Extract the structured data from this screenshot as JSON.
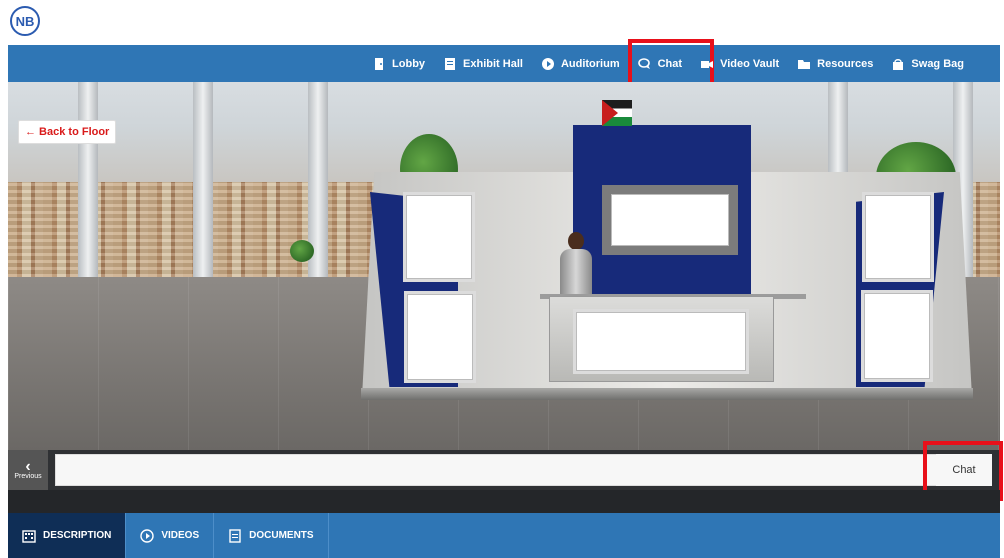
{
  "header": {
    "logo_text": "NB"
  },
  "nav": {
    "items": [
      {
        "label": "Lobby",
        "icon": "door-icon"
      },
      {
        "label": "Exhibit Hall",
        "icon": "booth-icon"
      },
      {
        "label": "Auditorium",
        "icon": "play-circle-icon"
      },
      {
        "label": "Chat",
        "icon": "chat-bubble-icon"
      },
      {
        "label": "Video Vault",
        "icon": "video-camera-icon"
      },
      {
        "label": "Resources",
        "icon": "folder-icon"
      },
      {
        "label": "Swag Bag",
        "icon": "bag-icon"
      }
    ]
  },
  "scene": {
    "back_label": "← Back to Floor"
  },
  "controls": {
    "previous_label": "Previous",
    "chat_label": "Chat"
  },
  "tabs": [
    {
      "label": "DESCRIPTION",
      "icon": "building-icon",
      "active": true
    },
    {
      "label": "VIDEOS",
      "icon": "play-circle-icon",
      "active": false
    },
    {
      "label": "DOCUMENTS",
      "icon": "document-icon",
      "active": false
    }
  ],
  "colors": {
    "primary": "#2f76b5",
    "dark": "#2f3134",
    "highlight": "#e8101a",
    "booth_blue": "#172a7a"
  }
}
